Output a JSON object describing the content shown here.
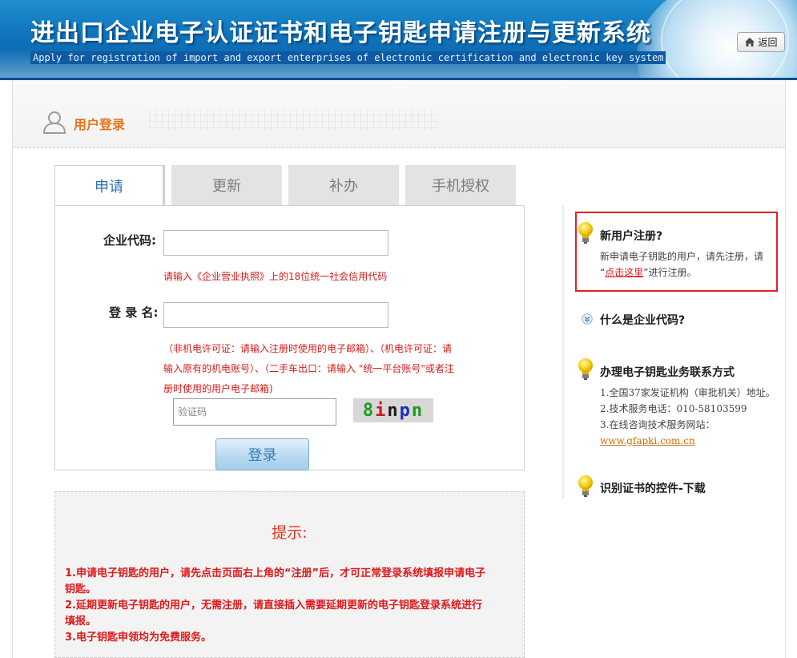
{
  "header": {
    "title": "进出口企业电子认证证书和电子钥匙申请注册与更新系统",
    "subtitle": "Apply for registration of import and export enterprises of electronic certification and electronic key system",
    "back_label": "返回"
  },
  "login": {
    "title": "用户登录",
    "tabs": [
      {
        "label": "申请",
        "active": true
      },
      {
        "label": "更新",
        "active": false
      },
      {
        "label": "补办",
        "active": false
      },
      {
        "label": "手机授权",
        "active": false
      }
    ],
    "company_code_label": "企业代码:",
    "company_code_hint": "请输入《企业营业执照》上的18位统一社会信用代码",
    "login_name_label": "登 录 名:",
    "login_name_hint_1": "（非机电许可证：请输入注册时使用的电子邮箱）、（机电许可证：请",
    "login_name_hint_2": "输入原有的机电账号）、（二手车出口：请输入 \"统一平台账号\"或者注",
    "login_name_hint_3": "册时使用的用户电子邮箱)",
    "captcha_placeholder": "验证码",
    "captcha_chars": [
      "8",
      "i",
      " ",
      "n",
      "p",
      "n"
    ],
    "login_button": "登录"
  },
  "tips": {
    "title": "提示:",
    "line1a": "1.申请电子钥匙的用户，请先点击页面右上角的“注册”后，才可正常登录系统填报申请电子",
    "line1b": "钥匙。",
    "line2a": "2.延期更新电子钥匙的用户，无需注册，请直接插入需要延期更新的电子钥匙登录系统进行",
    "line2b": "填报。",
    "line3": "3.电子钥匙申领均为免费服务。"
  },
  "sidebar": {
    "new_user": {
      "title": "新用户注册?",
      "text_1": "新申请电子钥匙的用户，请先注册，请",
      "text_2_prefix": "“",
      "link": "点击这里",
      "text_2_suffix": "”进行注册。"
    },
    "what_is_code": {
      "title": "什么是企业代码?"
    },
    "contact": {
      "title": "办理电子钥匙业务联系方式",
      "line1": "1.全国37家发证机构（审批机关）地址。",
      "line2": "2.技术服务电话：010-58103599",
      "line3": "3.在线咨询技术服务网站：",
      "website": "www.gfapki.com.cn"
    },
    "control": {
      "title": "识别证书的控件-下载"
    }
  },
  "colors": {
    "accent_orange": "#e8721b",
    "tab_active_text": "#2b72b7",
    "hint_red": "#d41b1b",
    "banner_blue": "#0f73bb"
  }
}
